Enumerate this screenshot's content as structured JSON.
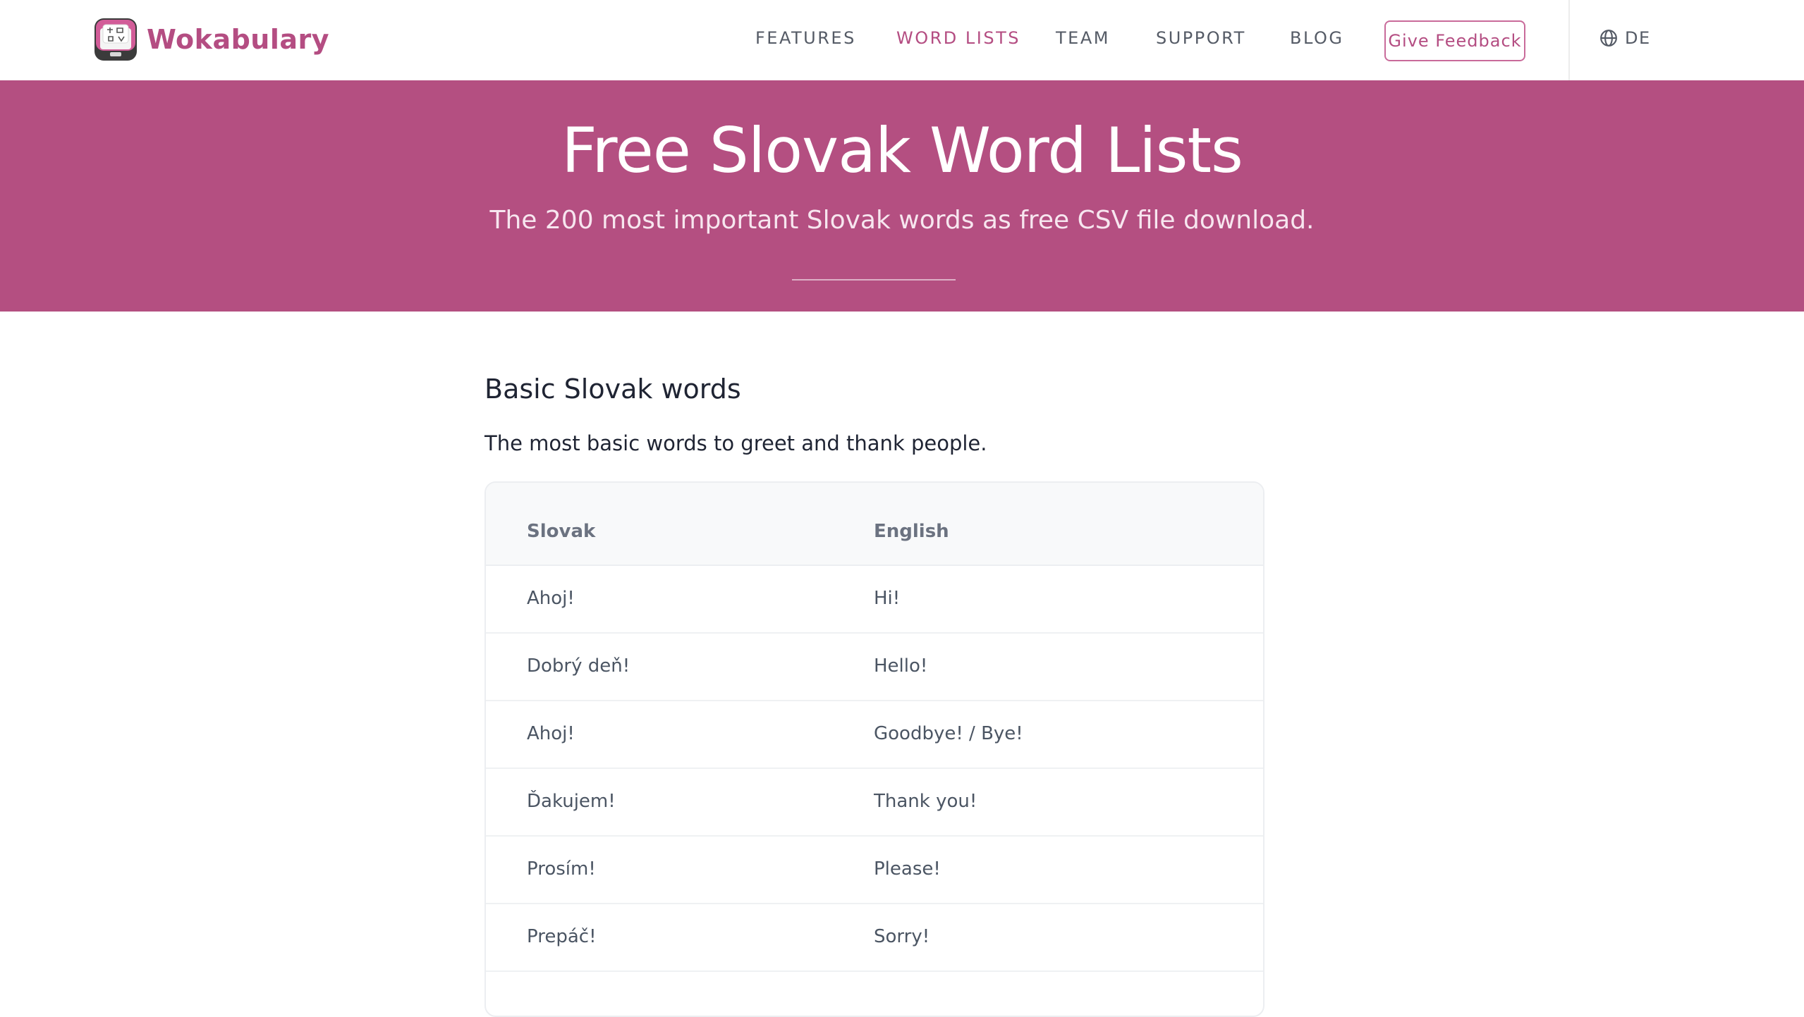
{
  "brand": {
    "name": "Wokabulary"
  },
  "nav": {
    "links": [
      {
        "label": "FEATURES",
        "active": false
      },
      {
        "label": "WORD LISTS",
        "active": true
      },
      {
        "label": "TEAM",
        "active": false
      },
      {
        "label": "SUPPORT",
        "active": false
      },
      {
        "label": "BLOG",
        "active": false
      }
    ],
    "feedback_label": "Give Feedback",
    "language_label": "DE"
  },
  "hero": {
    "title": "Free Slovak Word Lists",
    "subtitle": "The 200 most important Slovak words as free CSV file download."
  },
  "section": {
    "heading": "Basic Slovak words",
    "description": "The most basic words to greet and thank people.",
    "table": {
      "columns": [
        "Slovak",
        "English"
      ],
      "rows": [
        [
          "Ahoj!",
          "Hi!"
        ],
        [
          "Dobrý deň!",
          "Hello!"
        ],
        [
          "Ahoj!",
          "Goodbye! / Bye!"
        ],
        [
          "Ďakujem!",
          "Thank you!"
        ],
        [
          "Prosím!",
          "Please!"
        ],
        [
          "Prepáč!",
          "Sorry!"
        ]
      ]
    }
  },
  "colors": {
    "brand": "#b44d82",
    "hero_background": "#b44f81",
    "nav_text": "#555b66"
  },
  "icons": [
    "app-logo-icon",
    "globe-icon"
  ]
}
